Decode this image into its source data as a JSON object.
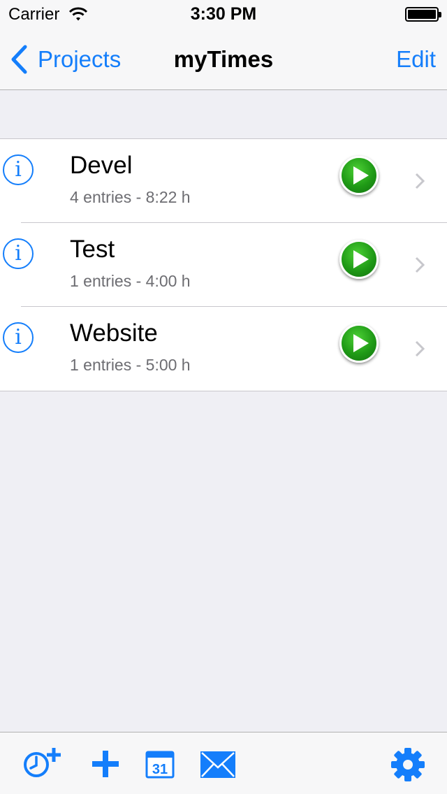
{
  "status_bar": {
    "carrier": "Carrier",
    "time": "3:30 PM"
  },
  "nav": {
    "back_label": "Projects",
    "title": "myTimes",
    "edit_label": "Edit"
  },
  "projects": [
    {
      "name": "Devel",
      "summary": "4 entries - 8:22 h"
    },
    {
      "name": "Test",
      "summary": "1 entries - 4:00 h"
    },
    {
      "name": "Website",
      "summary": "1 entries - 5:00 h"
    }
  ],
  "toolbar": {
    "calendar_day": "31",
    "icons": [
      "add-timer-icon",
      "plus-icon",
      "calendar-icon",
      "mail-icon",
      "gear-icon"
    ]
  },
  "colors": {
    "accent": "#147efb",
    "play_green": "#1f9a16",
    "background": "#efeff4"
  }
}
